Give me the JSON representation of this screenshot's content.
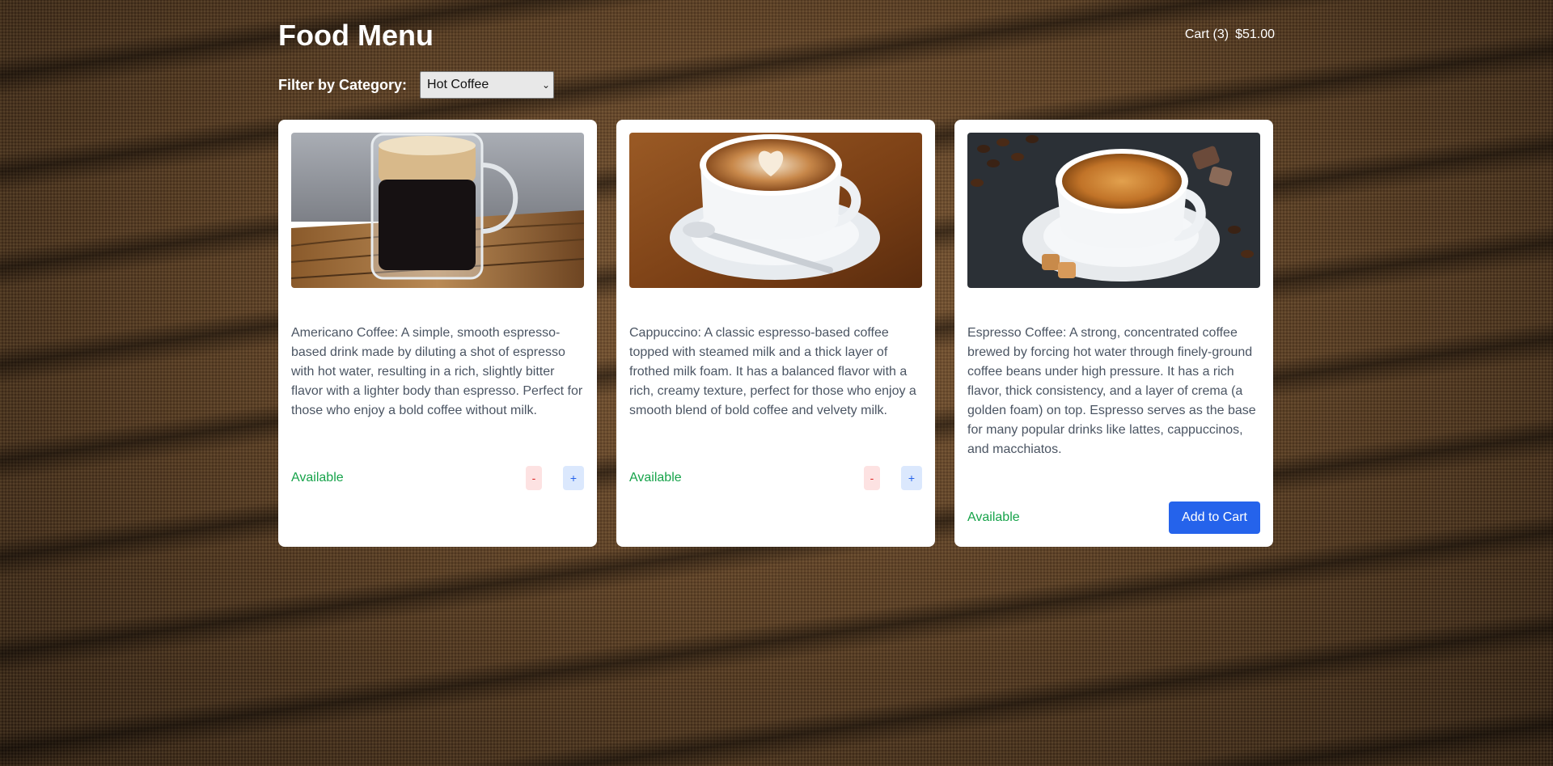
{
  "header": {
    "title": "Food Menu",
    "cart_label": "Cart (3)",
    "cart_total": "$51.00"
  },
  "filter": {
    "label": "Filter by Category:",
    "selected": "Hot Coffee"
  },
  "items": [
    {
      "image": "americano-photo",
      "description": "Americano Coffee: A simple, smooth espresso-based drink made by diluting a shot of espresso with hot water, resulting in a rich, slightly bitter flavor with a lighter body than espresso. Perfect for those who enjoy a bold coffee without milk.",
      "status": "Available",
      "minus_label": "-",
      "plus_label": "+"
    },
    {
      "image": "cappuccino-photo",
      "description": "Cappuccino: A classic espresso-based coffee topped with steamed milk and a thick layer of frothed milk foam. It has a balanced flavor with a rich, creamy texture, perfect for those who enjoy a smooth blend of bold coffee and velvety milk.",
      "status": "Available",
      "minus_label": "-",
      "plus_label": "+"
    },
    {
      "image": "espresso-photo",
      "description": "Espresso Coffee: A strong, concentrated coffee brewed by forcing hot water through finely-ground coffee beans under high pressure. It has a rich flavor, thick consistency, and a layer of crema (a golden foam) on top. Espresso serves as the base for many popular drinks like lattes, cappuccinos, and macchiatos.",
      "status": "Available",
      "button_label": "Add to Cart"
    }
  ],
  "colors": {
    "accent": "#2563eb",
    "available": "#16a34a",
    "minus": "#dc2626"
  }
}
